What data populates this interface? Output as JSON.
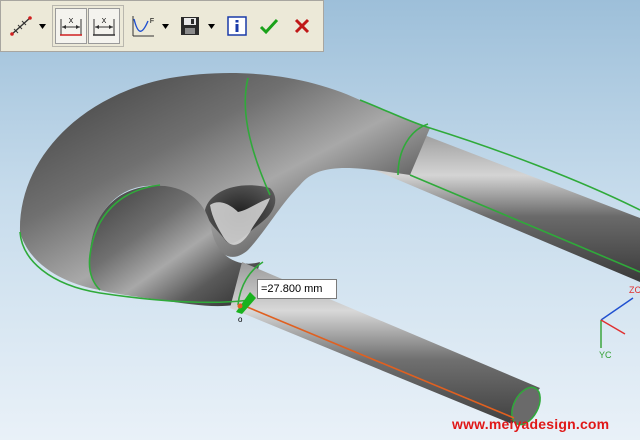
{
  "toolbar": {
    "buttons": [
      {
        "icon": "ruler-measure-icon",
        "has_dropdown": true
      },
      {
        "icon": "dimension-x-icon",
        "pressed": true
      },
      {
        "icon": "dimension-x-alt-icon",
        "pressed": true
      },
      {
        "icon": "curve-function-icon",
        "has_dropdown": true
      },
      {
        "icon": "save-icon",
        "has_dropdown": true
      },
      {
        "icon": "info-icon"
      },
      {
        "icon": "ok-check-icon"
      },
      {
        "icon": "cancel-x-icon"
      }
    ],
    "dim_label_x": "X",
    "fn_label": "F"
  },
  "measurement": {
    "value_text": "=27.800 mm"
  },
  "point_label": "o",
  "axes": {
    "z_label": "ZC",
    "y_label": "YC",
    "colors": {
      "x": "#e03030",
      "y": "#30a030",
      "z": "#2050d0"
    }
  },
  "watermark": "www.meiyadesign.com",
  "colors": {
    "edge": "#2faa3a",
    "measure_line": "#e06020",
    "body_dark": "#3a3a3a",
    "body_light": "#c8c8c8",
    "toolbar_bg": "#ece9d8"
  }
}
